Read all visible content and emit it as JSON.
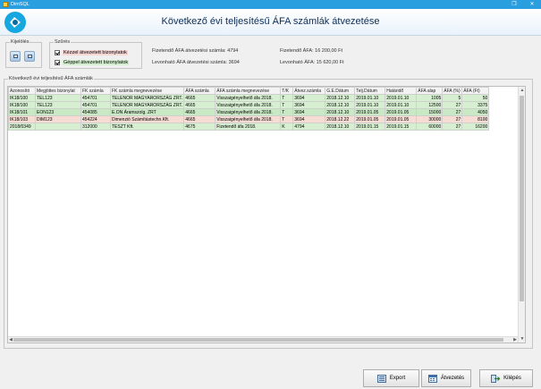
{
  "window": {
    "title": "DimSQL",
    "controls": {
      "restore": "❐",
      "close": "✕"
    }
  },
  "header": {
    "title": "Következő évi teljesítésű ÁFA számlák átvezetése"
  },
  "groups": {
    "selection": {
      "label": "Kijelölés"
    },
    "filter": {
      "label": "Szűrés",
      "manual": {
        "label": "Kézzel átvezetett bizonylatok",
        "checked": true
      },
      "machine": {
        "label": "Géppel átvezetett bizonylatok",
        "checked": true
      }
    }
  },
  "summary": {
    "payable_count_label": "Fizetendő ÁFA átvezetési számla:",
    "payable_count": "4794",
    "deductible_count_label": "Levonható ÁFA átvezetési számla:",
    "deductible_count": "3694",
    "payable_vat_label": "Fizetendő ÁFA:",
    "payable_vat": "16 200,00  Ft",
    "deductible_vat_label": "Levonható ÁFA:",
    "deductible_vat": "15 620,00  Ft"
  },
  "grid": {
    "label": "Következő évi teljesítésű ÁFA számlák",
    "columns": [
      "Azonosító",
      "Megjöttes bizonylat",
      "FK számla",
      "FK számla megnevezése",
      "ÁFA számla",
      "ÁFA számla megnevezése",
      "T/K",
      "Átvez.számla",
      "G.E.Dátum",
      "Telj.Dátum",
      "Határidő",
      "ÁFA alap",
      "ÁFA (%)",
      "ÁFA (Ft)"
    ],
    "rows": [
      {
        "c": [
          "IK18/100",
          "TEL123",
          "454701",
          "TELENOR MAGYARORSZÁG ZRT.",
          "4665",
          "Visszaigényelhető áfa 2018.",
          "T",
          "3694",
          "2018.12.10",
          "2019.01.10",
          "2019.01.10",
          "1005",
          "5",
          "50"
        ],
        "tone": "green"
      },
      {
        "c": [
          "IK18/100",
          "TEL123",
          "454701",
          "TELENOR MAGYARORSZÁG ZRT.",
          "4665",
          "Visszaigényelhető áfa 2018.",
          "T",
          "3694",
          "2018.12.10",
          "2019.01.10",
          "2019.01.10",
          "12500",
          "27",
          "3375"
        ],
        "tone": "green"
      },
      {
        "c": [
          "IK18/101",
          "EON123",
          "454085",
          "E.ON Áramszolg. ZRT",
          "4665",
          "Visszaigényelhető áfa 2018.",
          "T",
          "3694",
          "2018.12.10",
          "2019.01.05",
          "2019.01.05",
          "15000",
          "27",
          "4050"
        ],
        "tone": "green"
      },
      {
        "c": [
          "IK18/103",
          "DIM123",
          "454224",
          "Dimenzió Számítástechn.Kft.",
          "4665",
          "Visszaigényelhető áfa 2018.",
          "T",
          "3694",
          "2018.12.22",
          "2019.01.05",
          "2019.01.05",
          "30000",
          "27",
          "8100"
        ],
        "tone": "pink"
      },
      {
        "c": [
          "2018/0349",
          "",
          "312000",
          "TESZT Kft.",
          "4675",
          "Fizetendő áfa 2018.",
          "K",
          "4794",
          "2018.12.10",
          "2019.01.15",
          "2019.01.15",
          "60000",
          "27",
          "16200"
        ],
        "tone": "green"
      }
    ]
  },
  "buttons": {
    "export": "Export",
    "transfer": "Átvezetés",
    "exit": "Kilépés"
  }
}
